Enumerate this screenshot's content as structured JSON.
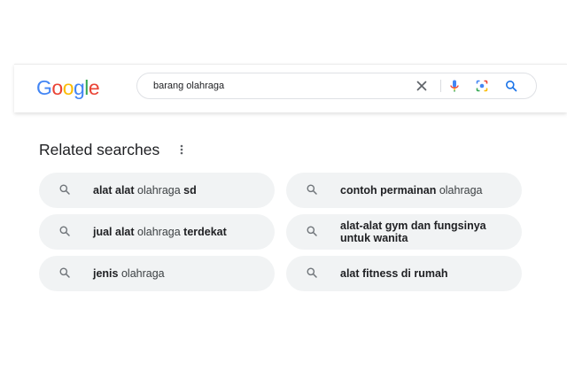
{
  "search": {
    "query": "barang olahraga"
  },
  "logo": {
    "letters": [
      "G",
      "o",
      "o",
      "g",
      "l",
      "e"
    ],
    "colors": [
      "#4285F4",
      "#EA4335",
      "#FBBC05",
      "#4285F4",
      "#34A853",
      "#EA4335"
    ]
  },
  "related": {
    "title": "Related searches",
    "items": [
      {
        "parts": [
          {
            "t": "alat alat",
            "b": true
          },
          {
            "t": " olahraga ",
            "b": false
          },
          {
            "t": "sd",
            "b": true
          }
        ]
      },
      {
        "parts": [
          {
            "t": "contoh permainan",
            "b": true
          },
          {
            "t": " olahraga",
            "b": false
          }
        ]
      },
      {
        "parts": [
          {
            "t": "jual alat",
            "b": true
          },
          {
            "t": " olahraga ",
            "b": false
          },
          {
            "t": "terdekat",
            "b": true
          }
        ]
      },
      {
        "parts": [
          {
            "t": "alat-alat gym dan fungsinya untuk wanita",
            "b": true
          }
        ]
      },
      {
        "parts": [
          {
            "t": "jenis",
            "b": true
          },
          {
            "t": " olahraga",
            "b": false
          }
        ]
      },
      {
        "parts": [
          {
            "t": "alat fitness di rumah",
            "b": true
          }
        ]
      }
    ]
  },
  "colors": {
    "mic_blue": "#4285F4",
    "mic_red": "#EA4335",
    "mic_yellow": "#FBBC05",
    "mic_green": "#34A853",
    "search_blue": "#1a73e8",
    "chip_bg": "#f1f3f4"
  },
  "icons": {
    "clear": "close-icon",
    "voice": "microphone-icon",
    "lens": "camera-icon",
    "search": "search-icon",
    "more": "more-vert-icon"
  }
}
